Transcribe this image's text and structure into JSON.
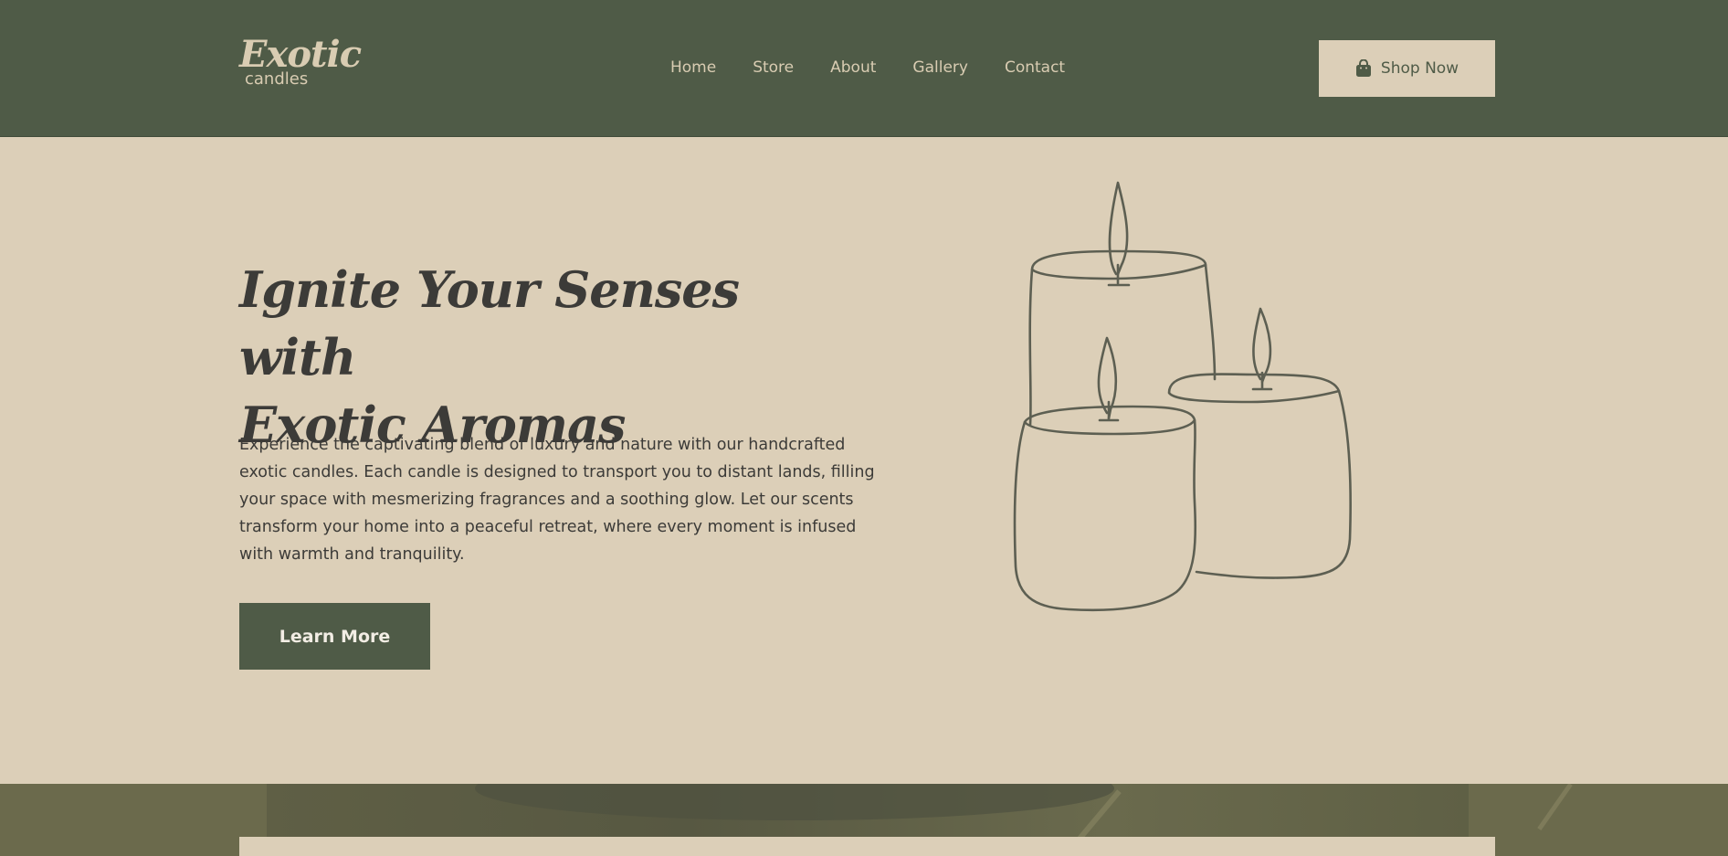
{
  "header": {
    "logo": {
      "brand": "Exotic",
      "sub": "candles"
    },
    "nav": [
      {
        "label": "Home"
      },
      {
        "label": "Store"
      },
      {
        "label": "About"
      },
      {
        "label": "Gallery"
      },
      {
        "label": "Contact"
      }
    ],
    "shop_button": {
      "label": "Shop Now",
      "icon": "shopping-bag-icon"
    }
  },
  "hero": {
    "title_line1": "Ignite Your Senses with",
    "title_line2": "Exotic Aromas",
    "description": "Experience the captivating blend of luxury and nature with our handcrafted exotic candles. Each candle is designed to transport you to distant lands, filling your space with mesmerizing fragrances and a soothing glow. Let our scents transform your home into a peaceful retreat, where every moment is infused with warmth and tranquility.",
    "cta_label": "Learn More",
    "illustration": "candles-illustration"
  },
  "colors": {
    "header_bg": "#4f5b47",
    "page_bg": "#dccfb8",
    "text_dark": "#3c3b38",
    "accent_light": "#d9ccb2"
  }
}
